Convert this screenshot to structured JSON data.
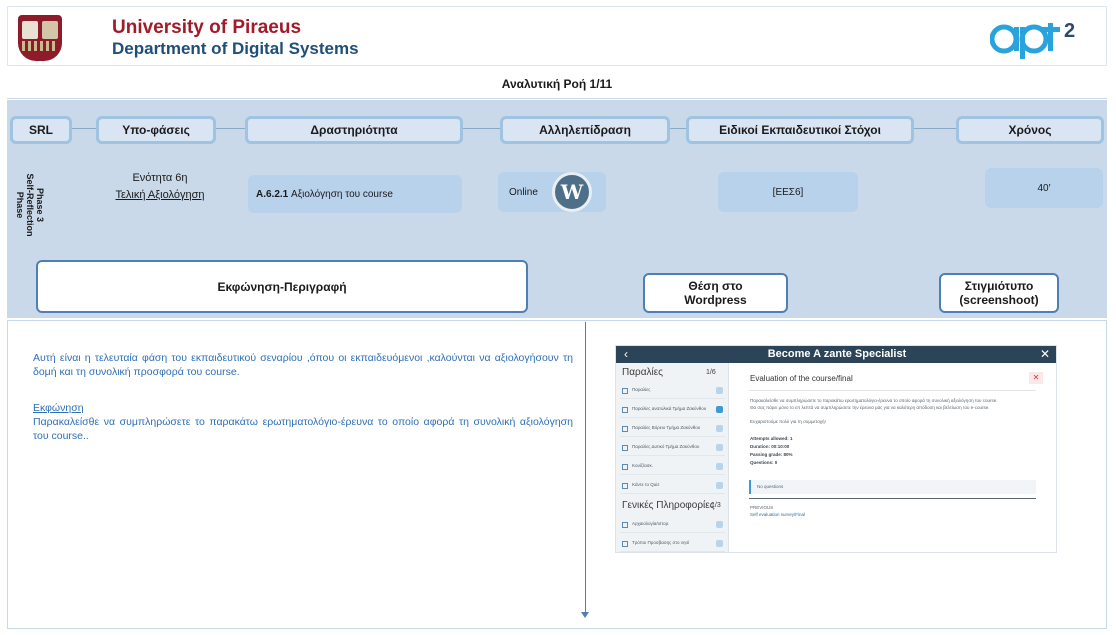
{
  "header": {
    "university": "University of Piraeus",
    "department": "Department of Digital Systems"
  },
  "title": "Αναλυτική Ροή 1/11",
  "columns": {
    "srl": "SRL",
    "subphases": "Υπο-φάσεις",
    "activity": "Δραστηριότητα",
    "interaction": "Αλληλεπίδραση",
    "objectives": "Ειδικοί Εκπαιδευτικοί Στόχοι",
    "time": "Χρόνος"
  },
  "row": {
    "phase": "Phase 3\nSelf-Reflection\nPhase",
    "unit": "Ενότητα 6η",
    "unit_title": "Τελική Αξιολόγηση",
    "activity_code": "A.6.2.1",
    "activity_text": "Αξιολόγηση του course",
    "interaction": "Online",
    "objectives": "[ΕΕΣ6]",
    "time": "40′"
  },
  "sections": {
    "description": "Εκφώνηση-Περιγραφή",
    "position": "Θέση στο Wordpress",
    "screenshot": "Στιγμιότυπο (screenshoot)"
  },
  "content": {
    "intro": "Αυτή είναι η τελευταία φάση του εκπαιδευτικού σεναρίου ,όπου οι εκπαιδευόμενοι ,καλούνται να αξιολογήσουν τη δομή και τη συνολική προσφορά του course.",
    "prompt_label": "Εκφώνηση",
    "prompt": "Παρακαλείσθε να συμπληρώσετε το παρακάτω ερωτηματολόγιο-έρευνα το οποίο αφορά τη συνολική αξιολόγηση του course.."
  },
  "screenshot": {
    "course_title": "Become A zante Specialist",
    "side_header1": "Παραλίες",
    "side_count1": "1/6",
    "side_items1": [
      "Παραλίες",
      "Παραλίες ανατολικά Τμήμα Ζακύνθου",
      "Παραλίες Βόρειο Τμήμα Ζακύνθου",
      "Παραλίες Δυτικό Τμήμα Ζακύνθου",
      "Κουίζ/ασκ.",
      "Κάντε το Quiz"
    ],
    "side_header2": "Γενικές Πληροφορίες",
    "side_count2": "1/3",
    "side_items2": [
      "Αρχαιολογία/ιστορ.",
      "Τρόποι Προσβασης στο νησί"
    ],
    "lesson_title": "Evaluation of the course/final",
    "text1": "Παρακαλείσθε να συμπληρώσετε το παρακάτω ερωτηματολόγιο-έρευνα το οποίο αφορά τη συνολική αξιολόγηση του course.",
    "text2": "Θα σας πάρει μόνο το επ λεπτά να συμπληρώσετε την έρευνα μας για να καλύτερη απόδοση και βελτίωση του e-course.",
    "text3": "Ευχαριστούμε πολύ για τη συμμετοχή!",
    "attempts": "Attempts allowed: 1",
    "duration": "Duration: 00:10:00",
    "passing": "Passing grade: 80%",
    "questions": "Questions: 0",
    "no_questions": "No questions",
    "previous": "PREVIOUS",
    "previous_link": "Self evaluation survey/Final"
  },
  "colors": {
    "band": "#c9d9ea",
    "header_border": "#9fc3e0",
    "section_border": "#4f7fb4",
    "text_blue": "#2e6fb7",
    "university_red": "#a11b2b",
    "department_blue": "#1f4e78"
  }
}
